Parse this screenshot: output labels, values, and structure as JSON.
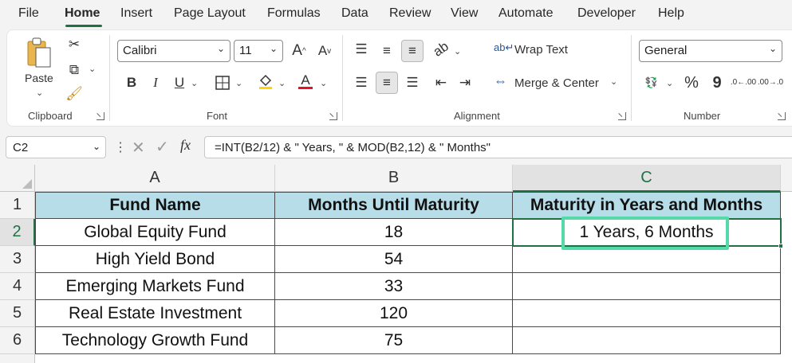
{
  "menu": {
    "tabs": [
      "File",
      "Home",
      "Insert",
      "Page Layout",
      "Formulas",
      "Data",
      "Review",
      "View",
      "Automate",
      "Developer",
      "Help"
    ],
    "active": "Home"
  },
  "ribbon": {
    "clipboard": {
      "paste_label": "Paste",
      "group_label": "Clipboard"
    },
    "font": {
      "font_name": "Calibri",
      "font_size": "11",
      "grow_label": "A",
      "shrink_label": "A",
      "bold": "B",
      "italic": "I",
      "underline": "U",
      "font_color_label": "A",
      "group_label": "Font"
    },
    "alignment": {
      "wrap_text_label": "Wrap Text",
      "merge_center_label": "Merge & Center",
      "group_label": "Alignment"
    },
    "number": {
      "format": "General",
      "percent": "%",
      "comma": "9",
      "inc_decimal": ".0←.00",
      "dec_decimal": ".00→.0",
      "group_label": "Number"
    }
  },
  "formula_bar": {
    "name_box": "C2",
    "fx_label": "fx",
    "formula": "=INT(B2/12) & \" Years, \" & MOD(B2,12) & \" Months\""
  },
  "sheet": {
    "columns": [
      "A",
      "B",
      "C"
    ],
    "rows": [
      "1",
      "2",
      "3",
      "4",
      "5",
      "6"
    ],
    "headers": [
      "Fund Name",
      "Months Until Maturity",
      "Maturity in Years and Months"
    ],
    "data": [
      [
        "Global Equity Fund",
        "18",
        "1 Years, 6 Months"
      ],
      [
        "High Yield Bond",
        "54",
        ""
      ],
      [
        "Emerging Markets Fund",
        "33",
        ""
      ],
      [
        "Real Estate Investment",
        "120",
        ""
      ],
      [
        "Technology Growth Fund",
        "75",
        ""
      ]
    ],
    "header_fill": "#b7dde8",
    "selection_color": "#1f7145",
    "highlight_color": "#56d9a8"
  }
}
